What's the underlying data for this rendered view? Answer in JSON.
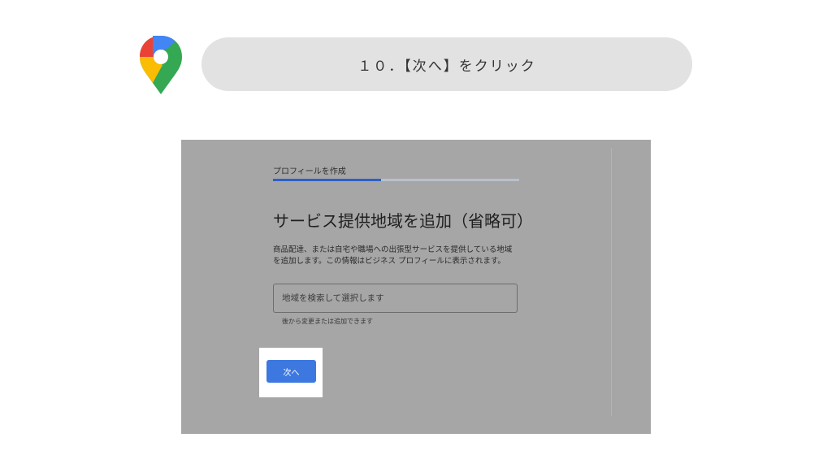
{
  "banner": {
    "step_text": "１０．【次へ】をクリック"
  },
  "logo": {
    "icon": "google-maps-pin-icon",
    "colors": {
      "red": "#ea4335",
      "yellow": "#fbbc04",
      "green": "#34a853",
      "blue": "#4285f4"
    }
  },
  "form": {
    "progress_label": "プロフィールを作成",
    "progress_fraction": 0.44,
    "title": "サービス提供地域を追加（省略可）",
    "description_lines": [
      "商品配達、または自宅や職場への出張型サービスを提供している地域",
      "を追加します。この情報はビジネス プロフィールに表示されます。"
    ],
    "search_placeholder": "地域を検索して選択します",
    "helper_text": "後から変更または追加できます",
    "next_label": "次へ"
  },
  "colors": {
    "accent": "#3d78e0",
    "progress": "#2f5fc4"
  }
}
